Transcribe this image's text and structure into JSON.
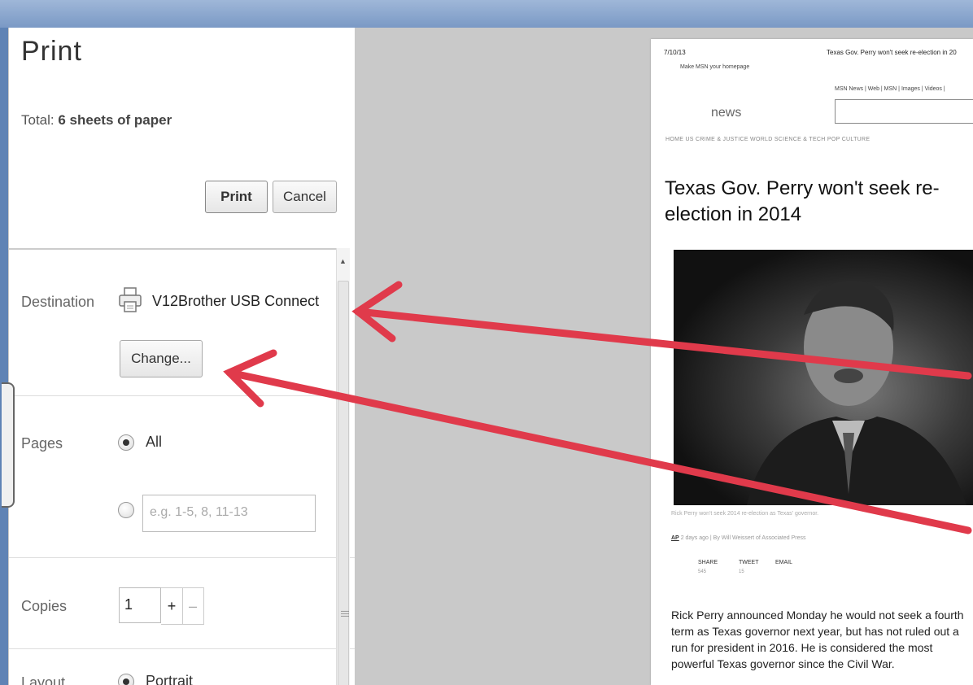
{
  "dialog": {
    "title": "Print",
    "total_prefix": "Total:",
    "total_value": "6 sheets of paper",
    "print_button": "Print",
    "cancel_button": "Cancel"
  },
  "destination": {
    "label": "Destination",
    "printer_name": "V12Brother USB Connect",
    "change_button": "Change..."
  },
  "pages": {
    "label": "Pages",
    "all_option": "All",
    "all_selected": true,
    "range_placeholder": "e.g. 1-5, 8, 11-13"
  },
  "copies": {
    "label": "Copies",
    "value": "1",
    "plus": "+",
    "minus": "–"
  },
  "layout": {
    "label": "Layout",
    "option": "Portrait"
  },
  "preview": {
    "date": "7/10/13",
    "header": "Texas Gov. Perry won't seek re-election in 20",
    "msn_home": "Make MSN your homepage",
    "links": "MSN News | Web | MSN | Images | Videos |",
    "section": "news",
    "nav": "HOME   US   CRIME & JUSTICE   WORLD   SCIENCE & TECH   POP CULTURE",
    "headline": "Texas Gov. Perry won't seek re-election in 2014",
    "caption": "Rick Perry won't seek 2014 re-election as Texas' governor.",
    "byline": "2 days ago | By Will Weissert of Associated Press",
    "ap_badge": "AP",
    "share": "SHARE",
    "share_count": "545",
    "tweet": "TWEET",
    "tweet_count": "15",
    "email": "EMAIL",
    "body": "Rick Perry announced Monday he would not seek a fourth term as Texas governor next year, but has not ruled out a run for president in 2016. He is considered the most powerful Texas governor since the Civil War."
  },
  "colors": {
    "annotation_arrow": "#e03a4b",
    "desktop_blue": "#5f83b5"
  }
}
